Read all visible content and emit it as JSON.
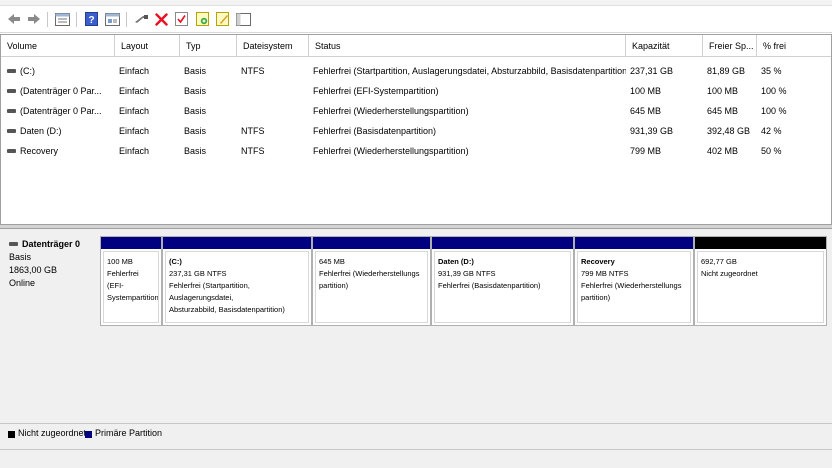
{
  "columns": [
    "Volume",
    "Layout",
    "Typ",
    "Dateisystem",
    "Status",
    "Kapazität",
    "Freier Sp...",
    "% frei"
  ],
  "volumes": [
    {
      "volume": "(C:)",
      "layout": "Einfach",
      "typ": "Basis",
      "fs": "NTFS",
      "status": "Fehlerfrei (Startpartition, Auslagerungsdatei, Absturzabbild, Basisdatenpartition)",
      "kapazitaet": "237,31 GB",
      "frei": "81,89 GB",
      "prozent": "35 %"
    },
    {
      "volume": "(Datenträger 0 Par...",
      "layout": "Einfach",
      "typ": "Basis",
      "fs": "",
      "status": "Fehlerfrei (EFI-Systempartition)",
      "kapazitaet": "100 MB",
      "frei": "100 MB",
      "prozent": "100 %"
    },
    {
      "volume": "(Datenträger 0 Par...",
      "layout": "Einfach",
      "typ": "Basis",
      "fs": "",
      "status": "Fehlerfrei (Wiederherstellungspartition)",
      "kapazitaet": "645 MB",
      "frei": "645 MB",
      "prozent": "100 %"
    },
    {
      "volume": "Daten (D:)",
      "layout": "Einfach",
      "typ": "Basis",
      "fs": "NTFS",
      "status": "Fehlerfrei (Basisdatenpartition)",
      "kapazitaet": "931,39 GB",
      "frei": "392,48 GB",
      "prozent": "42 %"
    },
    {
      "volume": "Recovery",
      "layout": "Einfach",
      "typ": "Basis",
      "fs": "NTFS",
      "status": "Fehlerfrei (Wiederherstellungspartition)",
      "kapazitaet": "799 MB",
      "frei": "402 MB",
      "prozent": "50 %"
    }
  ],
  "disk": {
    "name": "Datenträger 0",
    "type": "Basis",
    "size": "1863,00 GB",
    "state": "Online"
  },
  "partitions": [
    {
      "name": "",
      "size": "100 MB",
      "status1": "Fehlerfrei (EFI-",
      "status2": "Systempartition)",
      "kind": "primary"
    },
    {
      "name": "(C:)",
      "size": "237,31 GB NTFS",
      "status1": "Fehlerfrei (Startpartition, Auslagerungsdatei,",
      "status2": "Absturzabbild, Basisdatenpartition)",
      "kind": "primary"
    },
    {
      "name": "",
      "size": "645 MB",
      "status1": "Fehlerfrei (Wiederherstellungs",
      "status2": "partition)",
      "kind": "primary"
    },
    {
      "name": "Daten  (D:)",
      "size": "931,39 GB NTFS",
      "status1": "Fehlerfrei (Basisdatenpartition)",
      "status2": "",
      "kind": "primary"
    },
    {
      "name": "Recovery",
      "size": "799 MB NTFS",
      "status1": "Fehlerfrei (Wiederherstellungs",
      "status2": "partition)",
      "kind": "primary"
    },
    {
      "name": "",
      "size": "692,77 GB",
      "status1": "Nicht zugeordnet",
      "status2": "",
      "kind": "unallocated"
    }
  ],
  "legend": {
    "unallocated": "Nicht zugeordnet",
    "primary": "Primäre Partition"
  },
  "colors": {
    "primary": "#000080",
    "unallocated": "#000000",
    "error_x": "#e81123"
  },
  "toolbar_icons": [
    "back-arrow-icon",
    "forward-arrow-icon",
    "disk-list-icon",
    "help-icon",
    "properties-icon",
    "connect-drive-icon",
    "delete-x-icon",
    "checkmark-icon",
    "new-volume-icon",
    "edit-icon",
    "console-icon"
  ]
}
